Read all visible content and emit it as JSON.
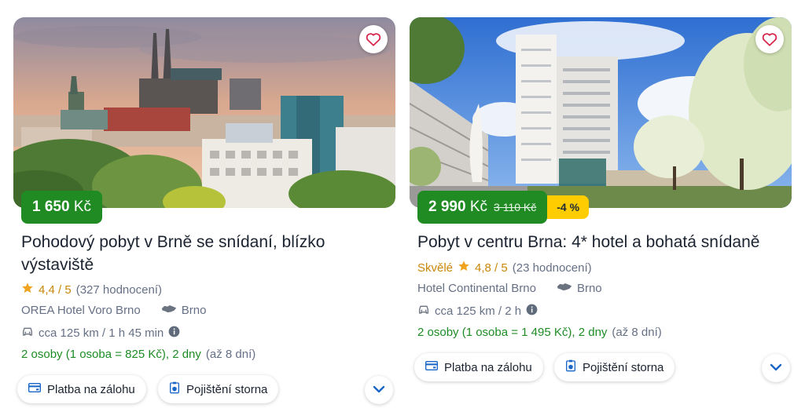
{
  "colors": {
    "price_green": "#1f8b22",
    "discount_yellow": "#ffcc00",
    "rating_gold": "#c9870a",
    "info_green": "#1e8c25",
    "chevron_blue": "#1a66c7",
    "heart_red": "#d6284d"
  },
  "cards": [
    {
      "price": "1 650",
      "currency": "Kč",
      "title": "Pohodový pobyt v Brně se snídaní, blízko výstaviště",
      "rating": "4,4 / 5",
      "reviews": "(327 hodnocení)",
      "hotel": "OREA Hotel Voro Brno",
      "city": "Brno",
      "travel": "cca 125 km / 1 h 45 min",
      "persons": "2 osoby (1 osoba = 825 Kč), 2 dny",
      "max_days": "(až 8 dní)",
      "pill_payment": "Platba na zálohu",
      "pill_insurance": "Pojištění storna"
    },
    {
      "price": "2 990",
      "currency": "Kč",
      "old_price": "3 110 Kč",
      "discount": "-4 %",
      "title": "Pobyt v centru Brna: 4* hotel a bohatá snídaně",
      "rating_label": "Skvělé",
      "rating": "4,8 / 5",
      "reviews": "(23 hodnocení)",
      "hotel": "Hotel Continental Brno",
      "city": "Brno",
      "travel": "cca 125 km / 2 h",
      "persons": "2 osoby (1 osoba = 1 495 Kč), 2 dny",
      "max_days": "(až 8 dní)",
      "pill_payment": "Platba na zálohu",
      "pill_insurance": "Pojištění storna"
    }
  ]
}
